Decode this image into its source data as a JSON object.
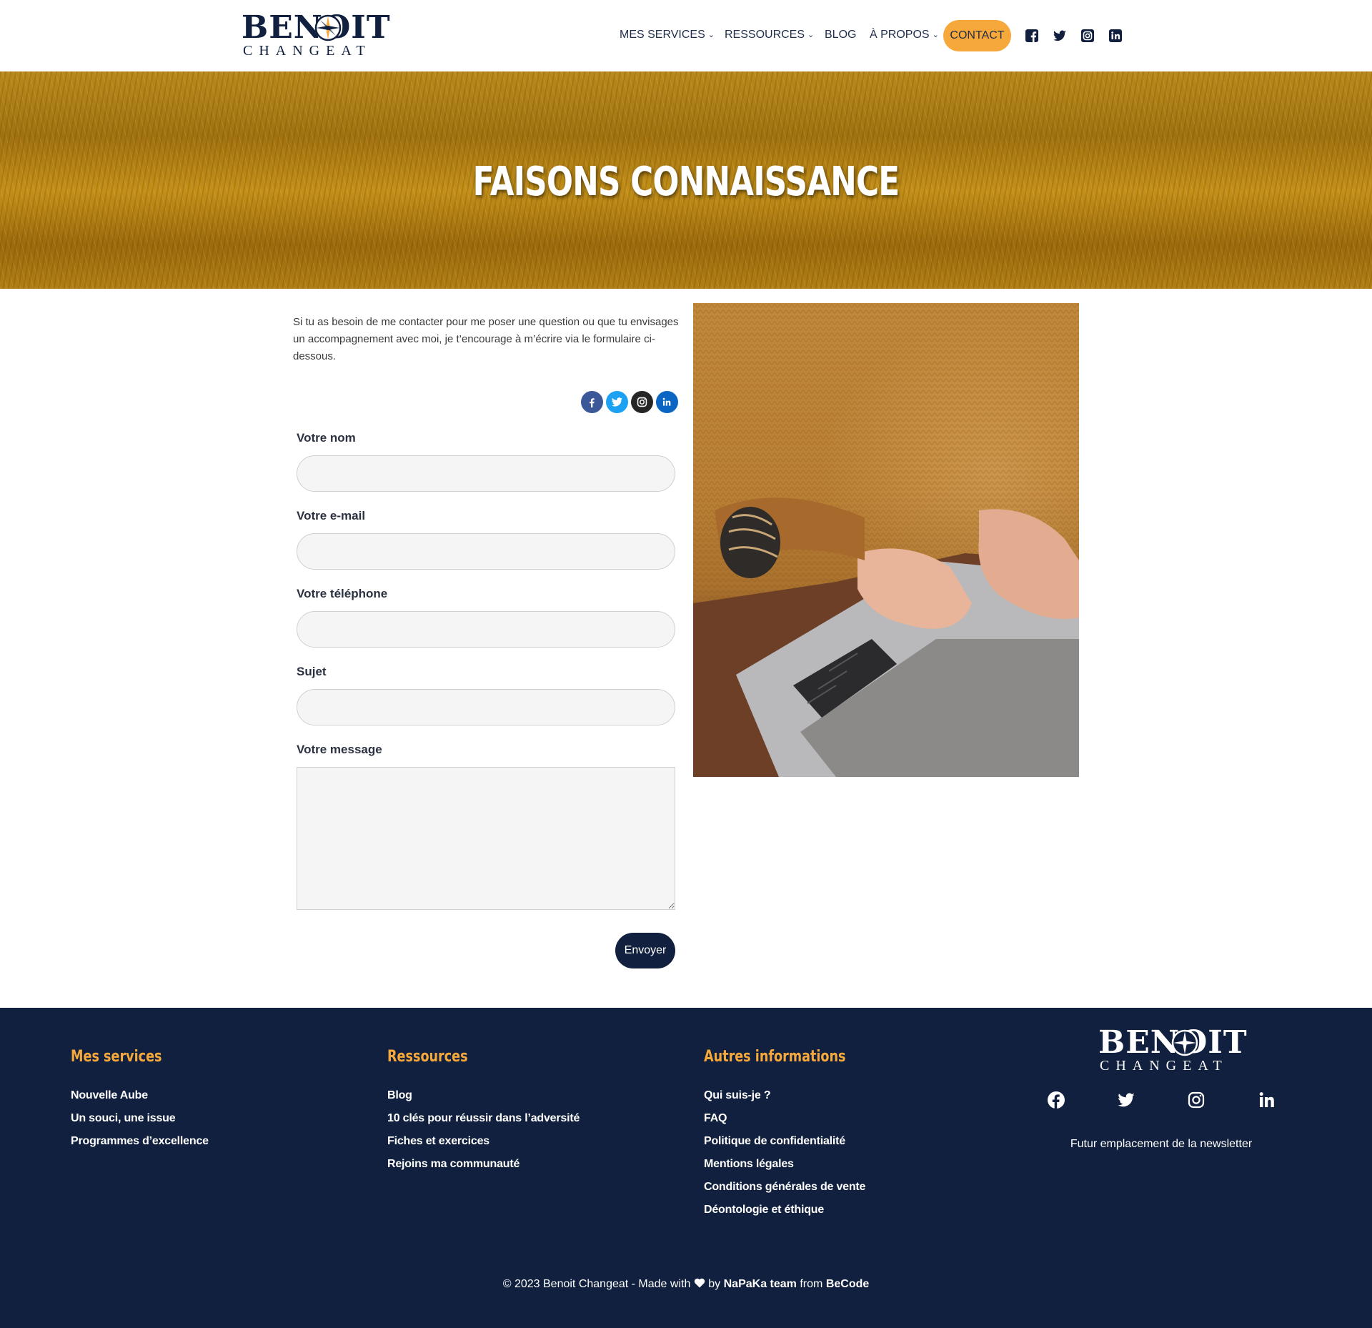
{
  "brand": {
    "name_main": "BENOIT",
    "name_sub": "CHANGEAT"
  },
  "nav": {
    "items": [
      {
        "label": "MES SERVICES",
        "has_dropdown": true
      },
      {
        "label": "RESSOURCES",
        "has_dropdown": true
      },
      {
        "label": "BLOG",
        "has_dropdown": false
      },
      {
        "label": "À PROPOS",
        "has_dropdown": true
      }
    ],
    "contact_label": "CONTACT",
    "dropdown_glyph": "⌄",
    "social_icons": [
      "facebook-icon",
      "twitter-icon",
      "instagram-icon",
      "linkedin-icon"
    ]
  },
  "hero": {
    "title": "FAISONS CONNAISSANCE"
  },
  "contact": {
    "intro": "Si tu as besoin de me contacter pour me poser une question ou que tu envisages un accompagnement avec moi, je t’encourage à m’écrire via le formulaire ci-dessous.",
    "social_icons": [
      "facebook-icon",
      "twitter-icon",
      "instagram-icon",
      "linkedin-icon"
    ],
    "fields": [
      {
        "label": "Votre nom",
        "value": ""
      },
      {
        "label": "Votre e-mail",
        "value": ""
      },
      {
        "label": "Votre téléphone",
        "value": ""
      },
      {
        "label": "Sujet",
        "value": ""
      }
    ],
    "message_label": "Votre message",
    "message_value": "",
    "submit_label": "Envoyer"
  },
  "footer": {
    "columns": [
      {
        "title": "Mes services",
        "links": [
          "Nouvelle Aube",
          "Un souci, une issue",
          "Programmes d’excellence"
        ]
      },
      {
        "title": "Ressources",
        "links": [
          "Blog",
          "10 clés pour réussir dans l’adversité",
          "Fiches et exercices",
          "Rejoins ma communauté"
        ]
      },
      {
        "title": "Autres informations",
        "links": [
          "Qui suis-je ?",
          "FAQ",
          "Politique de confidentialité",
          "Mentions légales",
          "Conditions générales de vente",
          "Déontologie et éthique"
        ]
      }
    ],
    "social_icons": [
      "facebook-icon",
      "twitter-icon",
      "instagram-icon",
      "linkedin-icon"
    ],
    "newsletter": "Futur emplacement de la newsletter",
    "copyright_prefix": "© 2023 Benoit Changeat - Made with",
    "copyright_by": "by",
    "copyright_team": "NaPaKa team",
    "copyright_from": "from",
    "copyright_org": "BeCode"
  },
  "colors": {
    "navy": "#10203e",
    "accent": "#f7a83a",
    "facebook": "#3b5998",
    "twitter": "#1da1f2",
    "instagram": "#262626",
    "linkedin": "#0a66c2"
  }
}
